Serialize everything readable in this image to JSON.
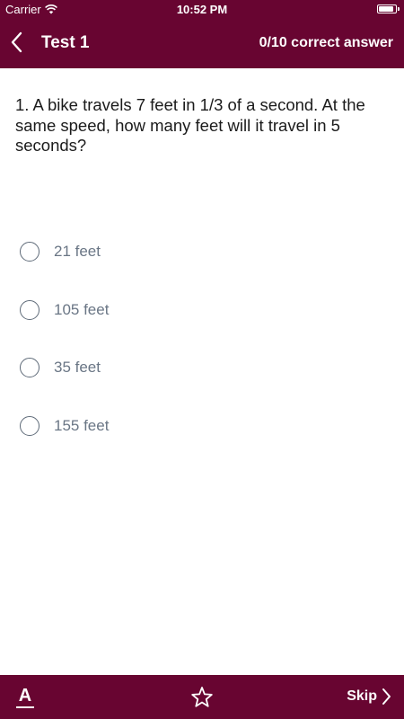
{
  "status_bar": {
    "carrier": "Carrier",
    "time": "10:52 PM",
    "battery_level": 1.0,
    "icons": [
      "wifi-icon",
      "battery-icon"
    ]
  },
  "nav": {
    "back_icon": "chevron-left-icon",
    "title": "Test 1",
    "score": "0/10 correct answer"
  },
  "question": {
    "text": "1. A bike travels 7 feet in 1/3 of a second. At the same speed, how many feet will it travel in 5 seconds?"
  },
  "answers": [
    {
      "label": "21 feet",
      "selected": false
    },
    {
      "label": "105 feet",
      "selected": false
    },
    {
      "label": "35 feet",
      "selected": false
    },
    {
      "label": "155 feet",
      "selected": false
    }
  ],
  "toolbar": {
    "font_glyph": "A",
    "font_icon": "font-size-icon",
    "star_icon": "star-outline-icon",
    "skip_label": "Skip",
    "skip_icon": "chevron-right-icon"
  },
  "colors": {
    "brand": "#680531",
    "question_text": "#1b1b1b",
    "answer_text": "#6a7685",
    "radio_border": "#5e6a78"
  }
}
